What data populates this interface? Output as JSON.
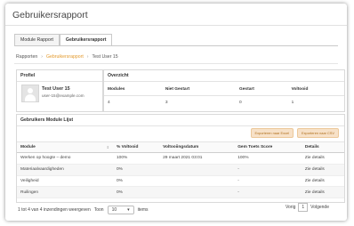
{
  "header": {
    "title": "Gebruikersrapport"
  },
  "tabs": [
    {
      "label": "Module Rapport",
      "active": false
    },
    {
      "label": "Gebruikersrapport",
      "active": true
    }
  ],
  "breadcrumb": [
    "Rapporten",
    "Gebruikersrapport",
    "Test User 15"
  ],
  "profile": {
    "heading": "Profiel",
    "name": "Test User 15",
    "email": "user-15@example.com"
  },
  "overview": {
    "heading": "Overzicht",
    "columns": [
      "Modules",
      "Niet Gestart",
      "Gestart",
      "Voltooid"
    ],
    "values": [
      "4",
      "3",
      "0",
      "1"
    ]
  },
  "modules": {
    "heading": "Gebruikers Module Lijst",
    "export_buttons": [
      "Exporteren naar Excel",
      "Exporteren naar CSV"
    ],
    "columns": [
      "Module",
      "% Voltooid",
      "Voltooiingsdatum",
      "Gem Toets Score",
      "Details"
    ],
    "rows": [
      [
        "Werken op hoogte – demo",
        "100%",
        "29 maart 2021 03:01",
        "100%",
        "Zie details"
      ],
      [
        "Materiaalvaardigheden",
        "0%",
        "",
        "-",
        "Zie details"
      ],
      [
        "Veiligheid",
        "0%",
        "",
        "-",
        "Zie details"
      ],
      [
        "Ruilingen",
        "0%",
        "",
        "-",
        "Zie details"
      ]
    ]
  },
  "footer": {
    "summary": "1 tot 4 van 4 inzendingen weergeven",
    "show_label": "Toon",
    "page_size": "10",
    "items_label": "items",
    "prev_label": "Vorig",
    "page": "1",
    "next_label": "Volgende"
  },
  "colors": {
    "accent": "#e39a2d",
    "export_bg": "#f7e1c8"
  }
}
